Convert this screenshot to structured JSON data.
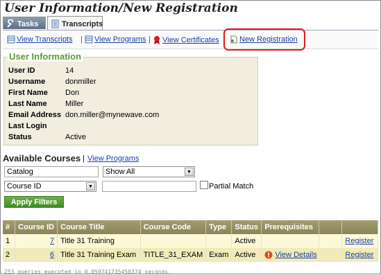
{
  "page": {
    "title": "User Information/New Registration"
  },
  "tabs": [
    {
      "label": "Tasks",
      "icon": "wrench-icon"
    },
    {
      "label": "Transcripts",
      "icon": "document-icon"
    }
  ],
  "toolbar": {
    "view_transcripts": "View Transcripts",
    "view_programs": "View Programs",
    "view_certificates": "View Certificates",
    "new_registration": "New Registration",
    "separator": "|"
  },
  "user_info": {
    "title": "User Information",
    "fields": [
      {
        "label": "User ID",
        "value": "14"
      },
      {
        "label": "Username",
        "value": "donmiller"
      },
      {
        "label": "First Name",
        "value": "Don"
      },
      {
        "label": "Last Name",
        "value": "Miller"
      },
      {
        "label": "Email Address",
        "value": "don.miller@mynewave.com"
      },
      {
        "label": "Last Login",
        "value": ""
      },
      {
        "label": "Status",
        "value": "Active"
      }
    ]
  },
  "available": {
    "title": "Available Courses",
    "separator": "|",
    "link": "View Programs",
    "catalog_value": "Catalog",
    "show_select": "Show All",
    "field_select": "Course ID",
    "search_value": "",
    "partial_match_label": "Partial Match",
    "apply_label": "Apply Filters"
  },
  "table": {
    "headers": [
      "#",
      "Course ID",
      "Course Title",
      "Course Code",
      "Type",
      "Status",
      "Prerequisites",
      "",
      ""
    ],
    "rows": [
      {
        "num": "1",
        "course_id": "7",
        "title": "Title 31 Training",
        "code": "",
        "type": "",
        "status": "Active",
        "prereq": "",
        "action": "Register"
      },
      {
        "num": "2",
        "course_id": "6",
        "title": "Title 31 Training Exam",
        "code": "TITLE_31_EXAM",
        "type": "Exam",
        "status": "Active",
        "prereq": "View Details",
        "action": "Register"
      }
    ]
  },
  "footer": {
    "note": "253 queries executed in 0.059741735458374 seconds."
  },
  "colors": {
    "highlight": "#e01b1b",
    "header_bg": "#9a9266",
    "section_title": "#5b9a2e",
    "link": "#1a3ea8"
  }
}
